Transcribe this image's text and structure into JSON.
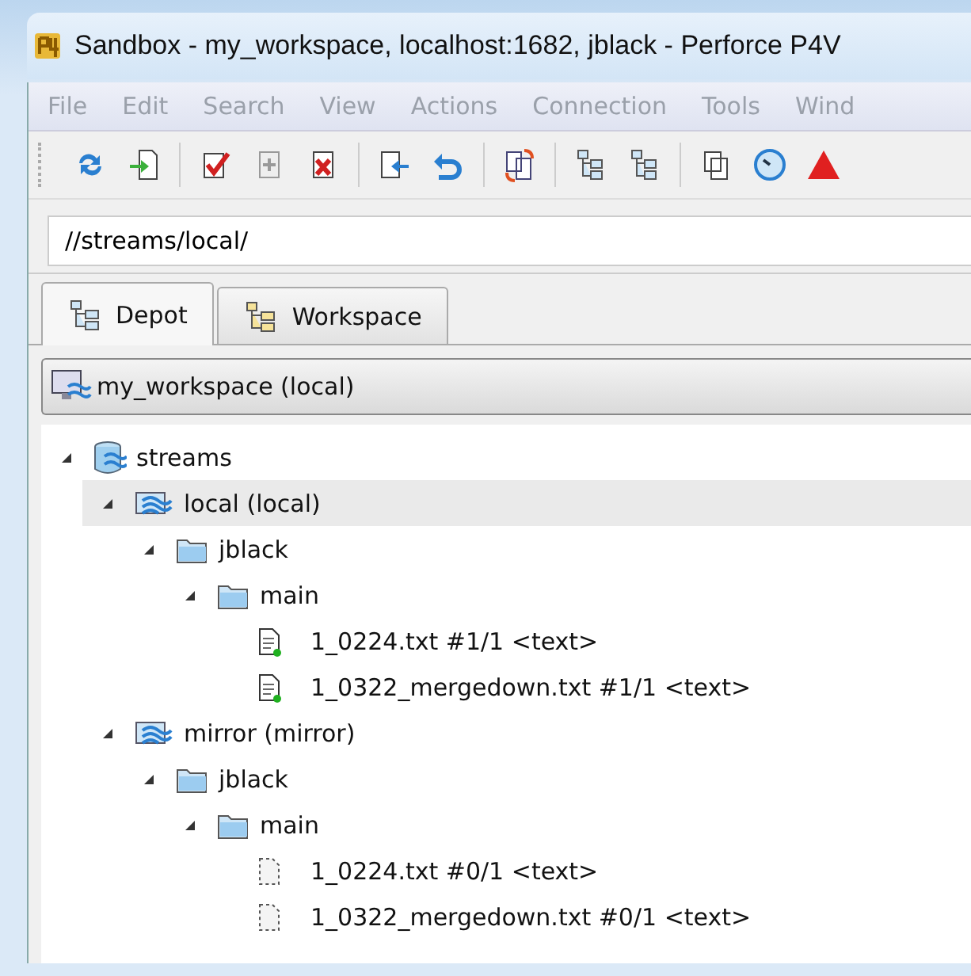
{
  "window": {
    "title": "Sandbox - my_workspace,  localhost:1682,  jblack - Perforce P4V"
  },
  "menu": [
    "File",
    "Edit",
    "Search",
    "View",
    "Actions",
    "Connection",
    "Tools",
    "Wind"
  ],
  "address": {
    "value": "//streams/local/"
  },
  "tabs": [
    {
      "label": "Depot",
      "selected": true
    },
    {
      "label": "Workspace",
      "selected": false
    }
  ],
  "workspace_bar": {
    "label": "my_workspace (local)"
  },
  "tree": [
    {
      "kind": "depot",
      "label": "streams",
      "expanded": true,
      "selected": false,
      "children": [
        {
          "kind": "stream",
          "label": "local (local)",
          "expanded": true,
          "selected": true,
          "children": [
            {
              "kind": "folder",
              "label": "jblack",
              "expanded": true,
              "selected": false,
              "children": [
                {
                  "kind": "folder",
                  "label": "main",
                  "expanded": true,
                  "selected": false,
                  "children": [
                    {
                      "kind": "file",
                      "label": "1_0224.txt #1/1 <text>",
                      "synced": true,
                      "selected": false
                    },
                    {
                      "kind": "file",
                      "label": "1_0322_mergedown.txt #1/1 <text>",
                      "synced": true,
                      "selected": false
                    }
                  ]
                }
              ]
            }
          ]
        },
        {
          "kind": "stream",
          "label": "mirror (mirror)",
          "expanded": true,
          "selected": false,
          "children": [
            {
              "kind": "folder",
              "label": "jblack",
              "expanded": true,
              "selected": false,
              "children": [
                {
                  "kind": "folder",
                  "label": "main",
                  "expanded": true,
                  "selected": false,
                  "children": [
                    {
                      "kind": "file",
                      "label": "1_0224.txt #0/1 <text>",
                      "synced": false,
                      "selected": false
                    },
                    {
                      "kind": "file",
                      "label": "1_0322_mergedown.txt #0/1 <text>",
                      "synced": false,
                      "selected": false
                    }
                  ]
                }
              ]
            }
          ]
        }
      ]
    }
  ]
}
